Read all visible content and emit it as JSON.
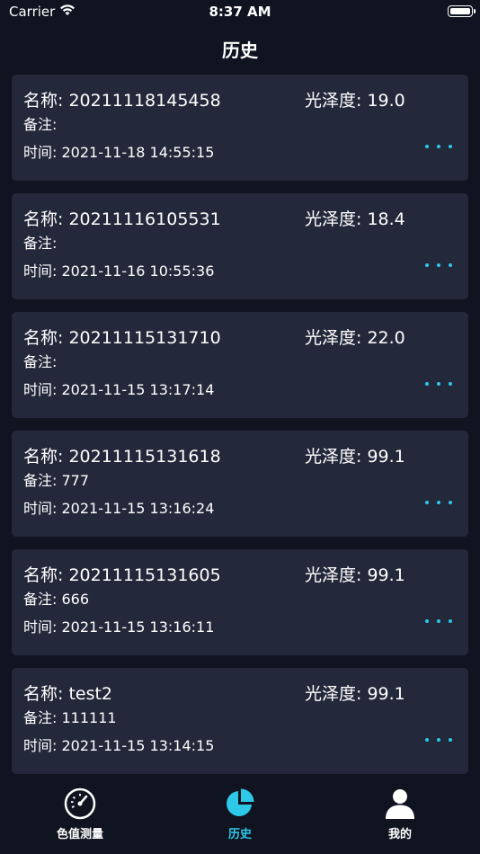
{
  "status": {
    "carrier": "Carrier",
    "time": "8:37 AM"
  },
  "nav": {
    "title": "历史"
  },
  "records": [
    {
      "name": "名称: 20211118145458",
      "gloss": "光泽度: 19.0",
      "remark": "备注:",
      "time": "时间: 2021-11-18 14:55:15"
    },
    {
      "name": "名称: 20211116105531",
      "gloss": "光泽度: 18.4",
      "remark": "备注:",
      "time": "时间: 2021-11-16 10:55:36"
    },
    {
      "name": "名称: 20211115131710",
      "gloss": "光泽度: 22.0",
      "remark": "备注:",
      "time": "时间: 2021-11-15 13:17:14"
    },
    {
      "name": "名称: 20211115131618",
      "gloss": "光泽度: 99.1",
      "remark": "备注: 777",
      "time": "时间: 2021-11-15 13:16:24"
    },
    {
      "name": "名称: 20211115131605",
      "gloss": "光泽度: 99.1",
      "remark": "备注: 666",
      "time": "时间: 2021-11-15 13:16:11"
    },
    {
      "name": "名称: test2",
      "gloss": "光泽度: 99.1",
      "remark": "备注: 111111",
      "time": "时间: 2021-11-15 13:14:15"
    }
  ],
  "tabs": [
    {
      "label": "色值测量",
      "icon": "gauge-icon"
    },
    {
      "label": "历史",
      "icon": "pie-chart-icon",
      "active": true
    },
    {
      "label": "我的",
      "icon": "person-icon"
    }
  ],
  "colors": {
    "accent": "#2ec8e8",
    "card": "#23283a",
    "background": "#0f1420"
  }
}
